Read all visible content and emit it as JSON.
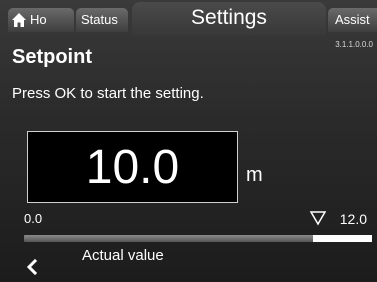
{
  "tabs": {
    "home_label": "Ho",
    "status_label": "Status",
    "settings_label": "Settings",
    "assist_label": "Assist"
  },
  "icons": {
    "home": "home-icon",
    "back": "chevron-left-icon",
    "marker": "triangle-down-outline-icon"
  },
  "menu_id": "3.1.1.0.0.0",
  "heading": "Setpoint",
  "instruction": "Press OK to start the setting.",
  "setpoint": {
    "value": "10.0",
    "unit": "m"
  },
  "range": {
    "min_label": "0.0",
    "max_label": "12.0",
    "actual_value_fraction": 0.17
  },
  "legend_label": "Actual value",
  "colors": {
    "background": "#2b2b2b",
    "text": "#ffffff",
    "bar_track": "#6b6b6b",
    "bar_fill": "#ffffff"
  }
}
